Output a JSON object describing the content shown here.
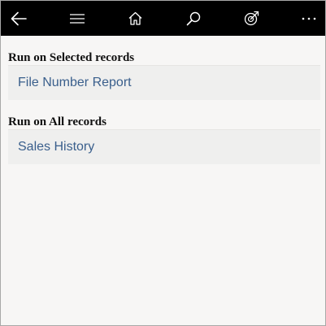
{
  "toolbar": {
    "buttons": [
      {
        "name": "back",
        "icon": "arrow-left-icon"
      },
      {
        "name": "menu",
        "icon": "hamburger-menu-icon"
      },
      {
        "name": "home",
        "icon": "home-icon"
      },
      {
        "name": "search",
        "icon": "search-icon"
      },
      {
        "name": "target",
        "icon": "target-arrow-icon"
      },
      {
        "name": "more",
        "icon": "more-dots-icon"
      }
    ],
    "background": "#000000",
    "icon_color": "#ffffff"
  },
  "sections": [
    {
      "heading": "Run on Selected records",
      "items": [
        {
          "label": "File Number Report"
        }
      ]
    },
    {
      "heading": "Run on All records",
      "items": [
        {
          "label": "Sales History"
        }
      ]
    }
  ],
  "colors": {
    "background": "#f7f6f5",
    "item_background": "#efefee",
    "link_text": "#3a5f8c",
    "heading_text": "#111111"
  }
}
